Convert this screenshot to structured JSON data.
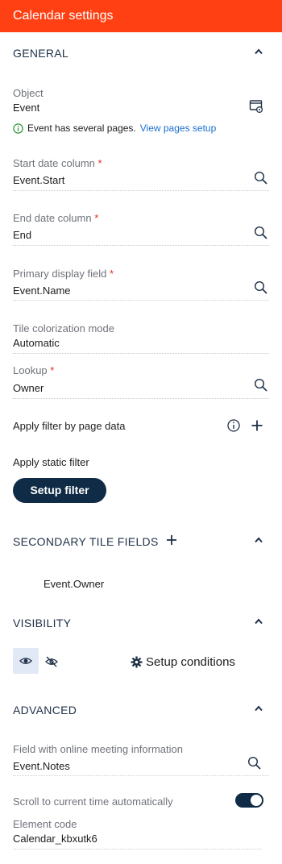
{
  "header": {
    "title": "Calendar settings"
  },
  "general": {
    "title": "GENERAL",
    "object": {
      "label": "Object",
      "value": "Event"
    },
    "info": {
      "text": "Event has several pages.",
      "link": "View pages setup"
    },
    "start_date": {
      "label": "Start date column",
      "required": "*",
      "value": "Event.Start"
    },
    "end_date": {
      "label": "End date column",
      "required": "*",
      "value": "End"
    },
    "primary_display": {
      "label": "Primary display field",
      "required": "*",
      "value": "Event.Name"
    },
    "colorization": {
      "label": "Tile colorization mode",
      "value": "Automatic"
    },
    "lookup": {
      "label": "Lookup",
      "required": "*",
      "value": "Owner"
    },
    "apply_filter_page": {
      "label": "Apply filter by page data"
    },
    "apply_static_filter": {
      "label": "Apply static filter",
      "button": "Setup filter"
    }
  },
  "secondary": {
    "title": "SECONDARY TILE FIELDS",
    "items": [
      "Event.Owner"
    ]
  },
  "visibility": {
    "title": "VISIBILITY",
    "setup_conditions": "Setup conditions"
  },
  "advanced": {
    "title": "ADVANCED",
    "online_meeting": {
      "label": "Field with online meeting information",
      "value": "Event.Notes"
    },
    "scroll_label": "Scroll to current time automatically",
    "scroll_enabled": true,
    "element_code": {
      "label": "Element code",
      "value": "Calendar_kbxutk6"
    }
  },
  "colors": {
    "accent": "#ff4013",
    "primary_dark": "#0f2b46",
    "link": "#1a6fd0",
    "required": "#e0301e"
  }
}
